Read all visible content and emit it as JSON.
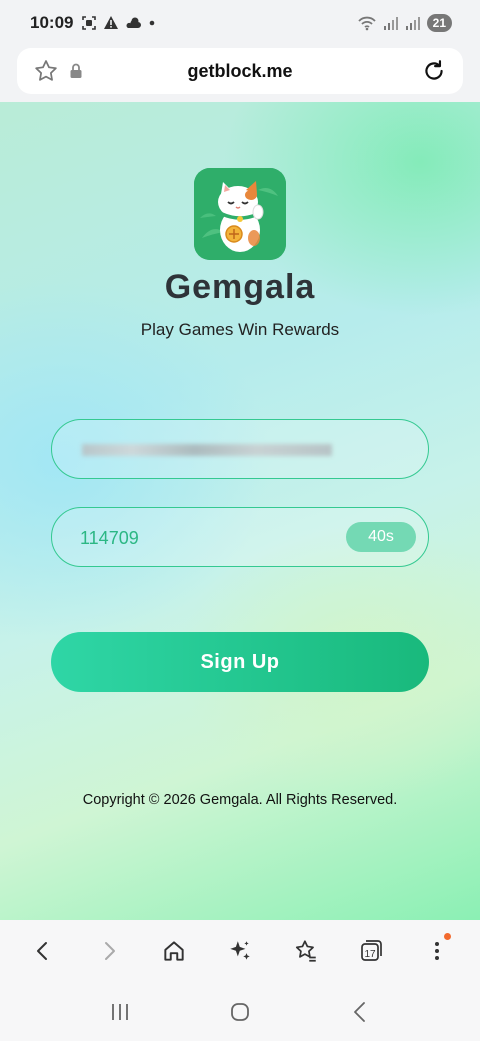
{
  "status_bar": {
    "time": "10:09",
    "battery": "21",
    "icons": [
      "screenshot-icon",
      "warning-icon",
      "weather-icon",
      "dot-icon",
      "wifi-icon",
      "signal-icon",
      "signal-icon"
    ]
  },
  "url_bar": {
    "url": "getblock.me",
    "icons": [
      "star-icon",
      "lock-icon",
      "reload-icon"
    ]
  },
  "app": {
    "name": "Gemgala",
    "tagline": "Play Games Win Rewards",
    "logo_icon": "lucky-cat-icon",
    "accent_color": "#1fc08a"
  },
  "form": {
    "email_value": "",
    "code_value": "114709",
    "timer": "40s",
    "submit_label": "Sign Up"
  },
  "footer": {
    "copyright": "Copyright © 2026 Gemgala. All Rights Reserved."
  },
  "browser_toolbar": {
    "tabs_count": "17",
    "icons": [
      "back-icon",
      "forward-icon",
      "home-icon",
      "sparkle-icon",
      "bookmarks-icon",
      "tabs-icon",
      "menu-icon"
    ]
  }
}
